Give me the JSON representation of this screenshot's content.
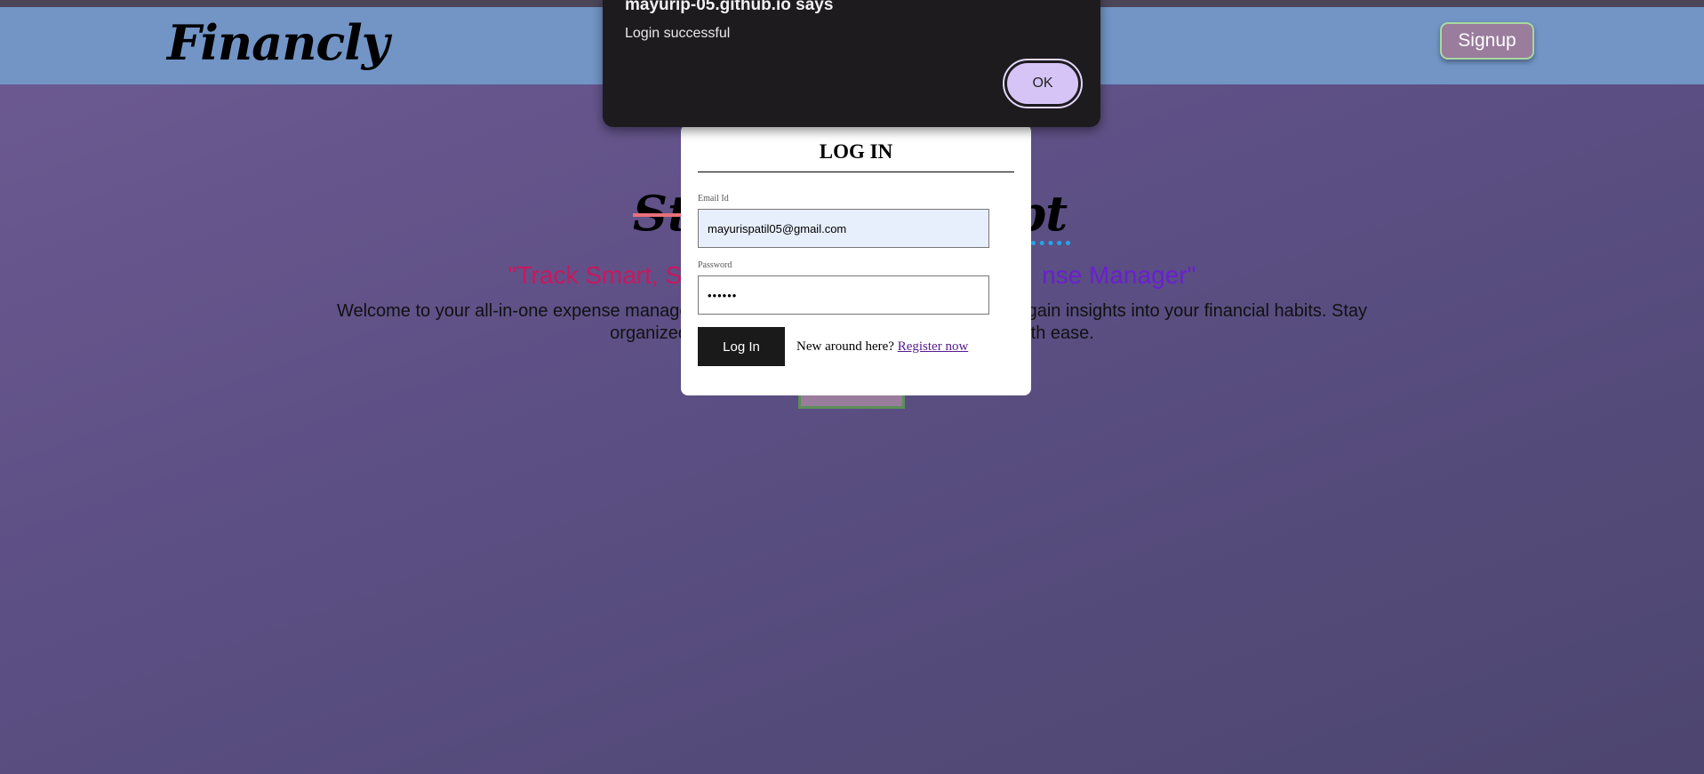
{
  "nav": {
    "logo": "Financly",
    "signup_label": "Signup"
  },
  "hero": {
    "word_left": "Sto",
    "word_right": "ipt",
    "tagline_start": "\"Track Smart, S",
    "tagline_end": "nse Manager\"",
    "welcome_line1": "Welcome to your all-in-one expense management solut                                  dgets, and gain insights into your financial habits. Stay",
    "welcome_line2": "organized, make s                                         l goals with ease."
  },
  "login": {
    "title": "LOG IN",
    "email_label": "Email Id",
    "email_value": "mayurispatil05@gmail.com",
    "password_label": "Password",
    "password_value": "••••••",
    "login_button": "Log In",
    "new_text": "New around here?",
    "register_link": "Register now"
  },
  "dialog": {
    "title": "mayurip-05.github.io says",
    "message": "Login successful",
    "ok_label": "OK"
  },
  "colors": {
    "navbar": "#7295c6",
    "signup_button": "#9a7c9c",
    "tagline_pink": "#c8185f",
    "tagline_purple": "#6a1fd0",
    "dialog_bg": "#1e1b1f",
    "ok_button": "#d7c4f7"
  }
}
